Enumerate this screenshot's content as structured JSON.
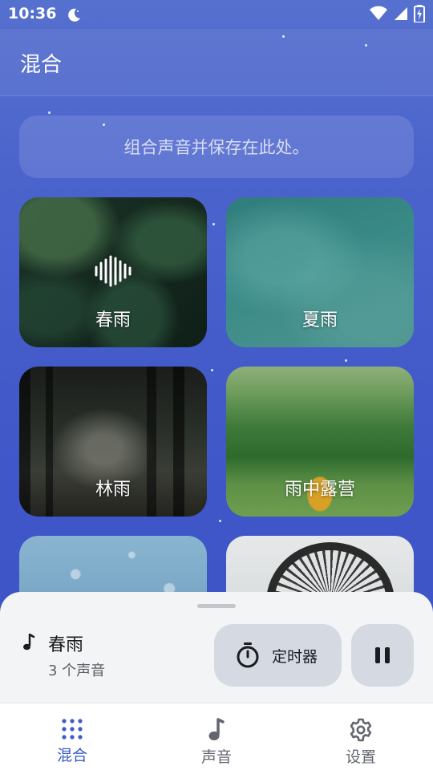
{
  "status_bar": {
    "time": "10:36"
  },
  "app_bar": {
    "title": "混合"
  },
  "info_banner": {
    "text": "组合声音并保存在此处。"
  },
  "mixes": [
    {
      "label": "春雨",
      "playing": true
    },
    {
      "label": "夏雨",
      "playing": false
    },
    {
      "label": "林雨",
      "playing": false
    },
    {
      "label": "雨中露营",
      "playing": false
    },
    {
      "label": "",
      "playing": false
    },
    {
      "label": "",
      "playing": false
    }
  ],
  "now_playing": {
    "title": "春雨",
    "subtitle": "3 个声音",
    "timer_label": "定时器"
  },
  "nav": {
    "items": [
      {
        "label": "混合",
        "icon": "grid-dots-icon",
        "active": true
      },
      {
        "label": "声音",
        "icon": "music-note-icon",
        "active": false
      },
      {
        "label": "设置",
        "icon": "gear-icon",
        "active": false
      }
    ]
  },
  "colors": {
    "background": "#3f57c8",
    "accent": "#3a5bc8",
    "sheet": "#f3f4f6",
    "button": "#d4d9e2"
  }
}
